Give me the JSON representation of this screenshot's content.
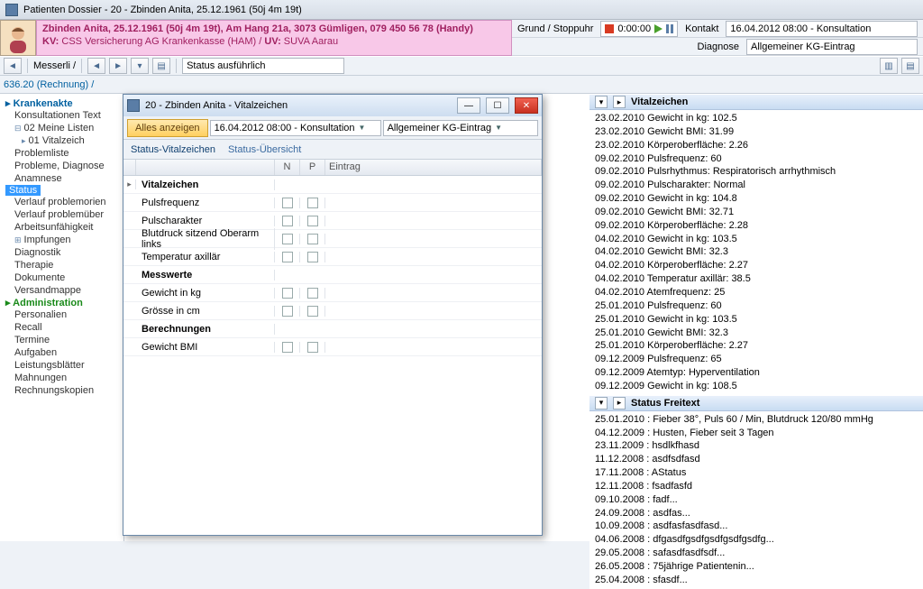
{
  "title": "Patienten Dossier - 20 - Zbinden Anita, 25.12.1961 (50j 4m 19t)",
  "patient": {
    "line1": "Zbinden Anita, 25.12.1961 (50j 4m 19t), Am Hang 21a, 3073 Gümligen, 079 450 56 78 (Handy)",
    "line2_prefix": "KV: ",
    "line2_a": "CSS Versicherung AG Krankenkasse (HAM)",
    "line2_mid": " / ",
    "line2_uv": "UV: ",
    "line2_b": "SUVA Aarau"
  },
  "right_row1": {
    "grund": "Grund / Stoppuhr",
    "time": "0:00:00",
    "kontakt": "Kontakt",
    "kontakt_value": "16.04.2012 08:00 - Konsultation"
  },
  "right_row2": {
    "diagnose": "Diagnose",
    "diag_value": "Allgemeiner KG-Eintrag"
  },
  "toolbar": {
    "messerli": "Messerli /",
    "status": "Status ausführlich"
  },
  "toolbar2": {
    "billing": "636.20 (Rechnung) /"
  },
  "tree": {
    "root": "Krankenakte",
    "items": [
      "Konsultationen Text",
      "02 Meine Listen",
      "01 Vitalzeich",
      "Problemliste",
      "Probleme, Diagnose",
      "Anamnese",
      "Status",
      "Verlauf problemorien",
      "Verlauf problemüber",
      "Arbeitsunfähigkeit",
      "Impfungen",
      "Diagnostik",
      "Therapie",
      "Dokumente",
      "Versandmappe"
    ],
    "admin": "Administration",
    "admin_items": [
      "Personalien",
      "Recall",
      "Termine",
      "Aufgaben",
      "Leistungsblätter",
      "Mahnungen",
      "Rechnungskopien"
    ]
  },
  "panel_vital": {
    "title": "Vitalzeichen",
    "rows": [
      "23.02.2010 Gewicht in kg: 102.5",
      "23.02.2010 Gewicht BMI: 31.99",
      "23.02.2010 Körperoberfläche: 2.26",
      "09.02.2010 Pulsfrequenz: 60",
      "09.02.2010 Pulsrhythmus: Respiratorisch arrhythmisch",
      "09.02.2010 Pulscharakter: Normal",
      "09.02.2010 Gewicht in kg: 104.8",
      "09.02.2010 Gewicht BMI: 32.71",
      "09.02.2010 Körperoberfläche: 2.28",
      "04.02.2010 Gewicht in kg: 103.5",
      "04.02.2010 Gewicht BMI: 32.3",
      "04.02.2010 Körperoberfläche: 2.27",
      "04.02.2010 Temperatur axillär: 38.5",
      "04.02.2010 Atemfrequenz: 25",
      "25.01.2010 Pulsfrequenz: 60",
      "25.01.2010 Gewicht in kg: 103.5",
      "25.01.2010 Gewicht BMI: 32.3",
      "25.01.2010 Körperoberfläche: 2.27",
      "09.12.2009 Pulsfrequenz: 65",
      "09.12.2009 Atemtyp: Hyperventilation",
      "09.12.2009 Gewicht in kg: 108.5"
    ]
  },
  "panel_freitext": {
    "title": "Status Freitext",
    "rows": [
      "25.01.2010 : Fieber 38°, Puls 60 / Min, Blutdruck 120/80 mmHg",
      "04.12.2009 : Husten, Fieber seit 3 Tagen",
      "23.11.2009 : hsdlkfhasd",
      "11.12.2008 : asdfsdfasd",
      "17.11.2008 : AStatus",
      "12.11.2008 : fsadfasfd",
      "09.10.2008 : fadf...",
      "24.09.2008 : asdfas...",
      "10.09.2008 : asdfasfasdfasd...",
      "04.06.2008 : dfgasdfgsdfgsdfgsdfgsdfg...",
      "29.05.2008 : safasdfasdfsdf...",
      "26.05.2008 : 75jährige Patientenin...",
      "25.04.2008 : sfasdf..."
    ]
  },
  "dialog": {
    "title": "20 - Zbinden Anita - Vitalzeichen",
    "show_all": "Alles anzeigen",
    "combo1": "16.04.2012 08:00 - Konsultation",
    "combo2": "Allgemeiner KG-Eintrag",
    "tab1": "Status-Vitalzeichen",
    "tab2": "Status-Übersicht",
    "head_n": "N",
    "head_p": "P",
    "head_e": "Eintrag",
    "rows": [
      {
        "name": "Vitalzeichen",
        "section": true
      },
      {
        "name": "Pulsfrequenz",
        "chk": true
      },
      {
        "name": "Pulscharakter",
        "chk": true
      },
      {
        "name": "Blutdruck sitzend Oberarm links",
        "chk": true
      },
      {
        "name": "Temperatur axillär",
        "chk": true
      },
      {
        "name": "Messwerte",
        "section": true
      },
      {
        "name": "Gewicht in kg",
        "chk": true
      },
      {
        "name": "Grösse in cm",
        "chk": true
      },
      {
        "name": "Berechnungen",
        "section": true
      },
      {
        "name": "Gewicht BMI",
        "chk": true
      }
    ]
  }
}
